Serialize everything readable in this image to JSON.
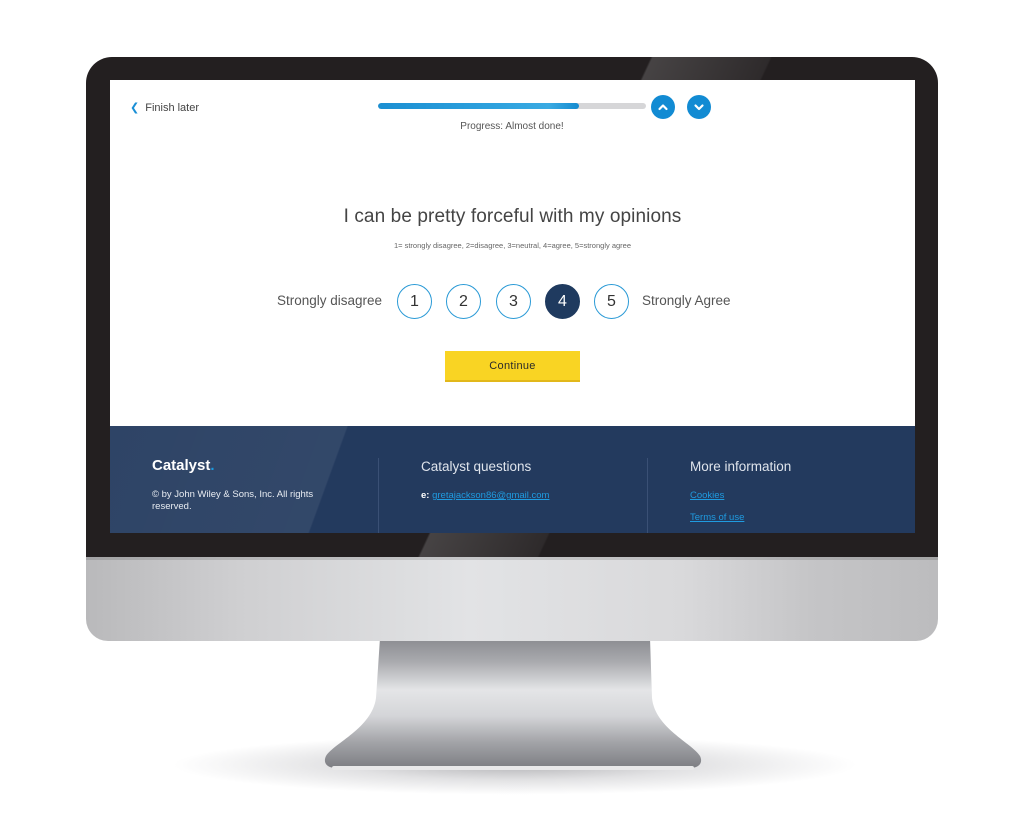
{
  "header": {
    "finish_later_label": "Finish later",
    "finish_later_icon": "chevron-left-icon",
    "progress": {
      "fraction": 0.75,
      "label": "Progress: Almost done!"
    },
    "nav_buttons": {
      "previous_icon": "chevron-up-icon",
      "next_icon": "chevron-down-icon"
    }
  },
  "question": {
    "text": "I can be pretty forceful with my opinions",
    "scale_hint": "1= strongly disagree, 2=disagree, 3=neutral, 4=agree, 5=strongly agree",
    "left_label": "Strongly disagree",
    "right_label": "Strongly Agree",
    "options": [
      "1",
      "2",
      "3",
      "4",
      "5"
    ],
    "selected": "4"
  },
  "actions": {
    "continue_label": "Continue"
  },
  "footer": {
    "logo_text": "Catalyst",
    "logo_dot": ".",
    "copyright": "© by John Wiley & Sons, Inc. All rights reserved.",
    "questions_heading": "Catalyst questions",
    "email_label": "e:",
    "email": "gretajackson86@gmail.com",
    "more_heading": "More information",
    "links": [
      "Cookies",
      "Terms of use"
    ]
  },
  "colors": {
    "accent_blue": "#128bd3",
    "selected_navy": "#1f3a5f",
    "continue_yellow": "#f9d423",
    "footer_navy": "#233a5e"
  }
}
